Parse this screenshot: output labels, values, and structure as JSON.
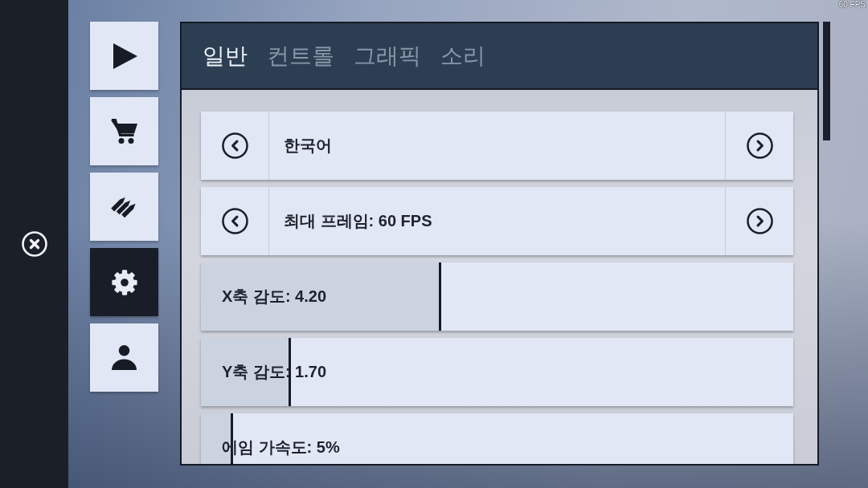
{
  "fps_counter": "60 FPS",
  "nav": [
    {
      "selected": false
    },
    {
      "selected": false
    },
    {
      "selected": false
    },
    {
      "selected": true
    },
    {
      "selected": false
    }
  ],
  "tabs": [
    {
      "label": "일반",
      "selected": true
    },
    {
      "label": "컨트롤",
      "selected": false
    },
    {
      "label": "그래픽",
      "selected": false
    },
    {
      "label": "소리",
      "selected": false
    }
  ],
  "settings": [
    {
      "kind": "selector",
      "label": "한국어"
    },
    {
      "kind": "selector",
      "label": "최대 프레임: 60 FPS"
    },
    {
      "kind": "slider",
      "label": "X축 감도: 4.20",
      "level": 0.406
    },
    {
      "kind": "slider",
      "label": "Y축 감도: 1.70",
      "level": 0.152
    },
    {
      "kind": "slider",
      "label": "에임 가속도: 5%",
      "level": 0.054
    }
  ]
}
